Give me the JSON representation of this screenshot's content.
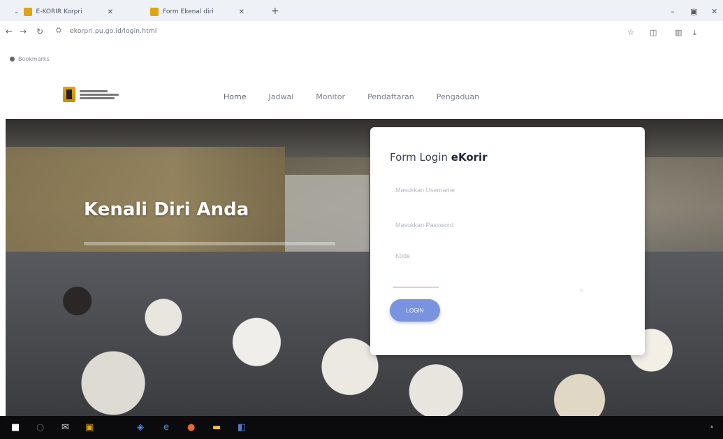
{
  "browser": {
    "tabs": [
      {
        "label": "E-KORIR Korpri",
        "favicon_color": "#e0a412"
      },
      {
        "label": "Form Ekenal diri",
        "favicon_color": "#e0a412"
      }
    ],
    "new_tab_icon": "plus-icon",
    "address": "ekorpri.pu.go.id/login.html",
    "bookmark": "Bookmarks"
  },
  "site": {
    "nav": [
      {
        "label": "Home"
      },
      {
        "label": "Jadwal"
      },
      {
        "label": "Monitor"
      },
      {
        "label": "Pendaftaran"
      },
      {
        "label": "Pengaduan"
      }
    ]
  },
  "hero": {
    "title": "Kenali Diri Anda"
  },
  "login": {
    "title_prefix": "Form Login ",
    "title_brand": "eKorir",
    "username_placeholder": "Masukkan Username",
    "password_placeholder": "Masukkan Password",
    "captcha_placeholder": "Kode",
    "button_label": "LOGIN",
    "button_color": "#7a93de"
  },
  "colors": {
    "accent": "#7a93de",
    "logo": "#e0a412"
  }
}
